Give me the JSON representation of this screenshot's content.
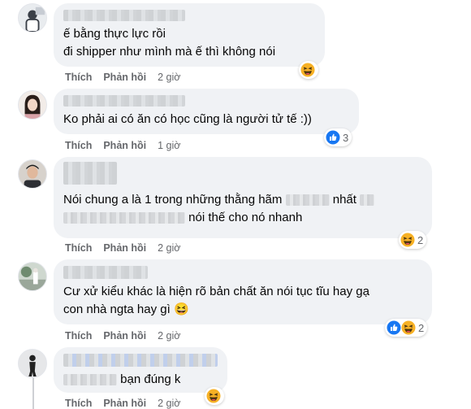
{
  "comments": [
    {
      "lines": [
        "ế bằng thực lực rồi",
        "đi shipper như mình mà ế thì không nói"
      ],
      "like_label": "Thích",
      "reply_label": "Phản hồi",
      "time": "2 giờ",
      "reactions": [
        "haha"
      ],
      "reaction_count": ""
    },
    {
      "lines": [
        "Ko phải ai có ăn có học cũng là người tử tế :))"
      ],
      "like_label": "Thích",
      "reply_label": "Phản hồi",
      "time": "1 giờ",
      "reactions": [
        "like"
      ],
      "reaction_count": "3"
    },
    {
      "line1_start": "Nói chung a là 1 trong những thằng hãm",
      "line1_end": "nhất",
      "line2_end": "nói thế cho nó nhanh",
      "like_label": "Thích",
      "reply_label": "Phản hồi",
      "time": "2 giờ",
      "reactions": [
        "haha"
      ],
      "reaction_count": "2"
    },
    {
      "lines": [
        "Cư xử kiểu khác là hiện rõ bản chất ăn nói tục tĩu hay gạ",
        "con nhà ngta hay gì 😆"
      ],
      "like_label": "Thích",
      "reply_label": "Phản hồi",
      "time": "2 giờ",
      "reactions": [
        "like",
        "haha"
      ],
      "reaction_count": "2"
    },
    {
      "text_end": "bạn đúng k",
      "like_label": "Thích",
      "reply_label": "Phản hồi",
      "time": "2 giờ",
      "reactions": [
        "haha"
      ],
      "reaction_count": ""
    }
  ],
  "colors": {
    "bubble": "#f0f2f5",
    "action_text": "#65676b",
    "like_blue": "#1877f2",
    "haha_yellow": "#f7b125"
  },
  "icons": {
    "like": "like-reaction-icon",
    "haha": "haha-reaction-icon"
  }
}
